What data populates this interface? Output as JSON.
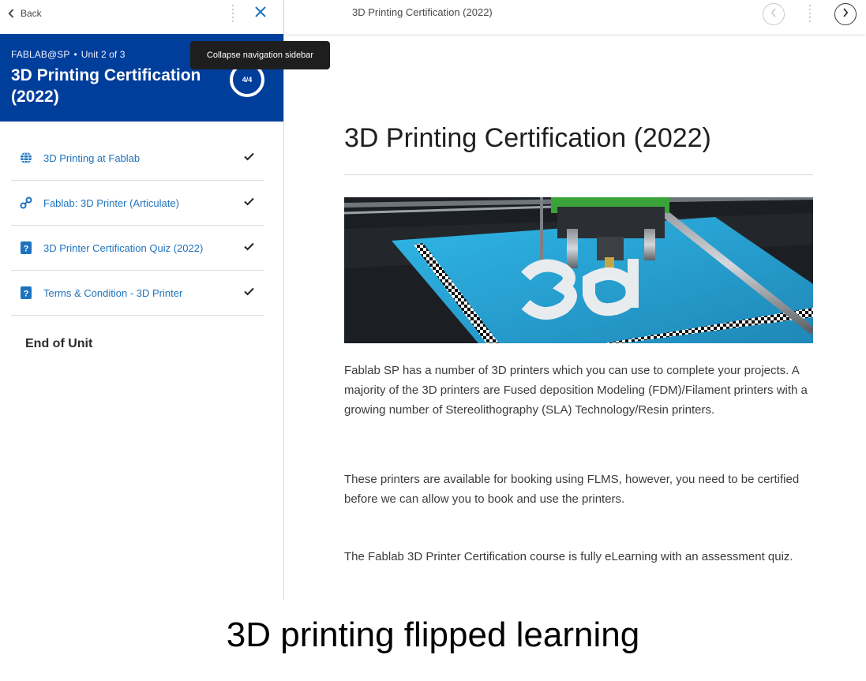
{
  "sidebar": {
    "back_label": "Back",
    "org": "FABLAB@SP",
    "unit_info": "Unit 2 of 3",
    "title": "3D Printing Certification (2022)",
    "progress": "4/4",
    "tooltip": "Collapse navigation sidebar",
    "items": [
      {
        "label": "3D Printing at Fablab",
        "icon": "globe-icon",
        "completed": true
      },
      {
        "label": "Fablab: 3D Printer (Articulate)",
        "icon": "link-icon",
        "completed": true
      },
      {
        "label": "3D Printer Certification Quiz (2022)",
        "icon": "quiz-icon",
        "completed": true
      },
      {
        "label": "Terms & Condition - 3D Printer",
        "icon": "quiz-icon",
        "completed": true
      }
    ],
    "end_label": "End of Unit"
  },
  "topbar": {
    "title": "3D Printing Certification (2022)"
  },
  "content": {
    "heading": "3D Printing Certification (2022)",
    "paragraphs": [
      "Fablab SP has a number of 3D printers which you can use to complete your projects.  A majority of the 3D printers are Fused deposition Modeling (FDM)/Filament printers with a growing number of Stereolithography (SLA) Technology/Resin printers.",
      "These printers are available for booking using FLMS, however, you need to be certified before we can allow you to book and use the printers.",
      "The Fablab 3D Printer Certification course is fully eLearning with an assessment quiz."
    ]
  },
  "caption": "3D printing flipped learning",
  "colors": {
    "brand_blue": "#003e9c",
    "link_blue": "#1e73be",
    "tooltip_bg": "#1e1e1e",
    "bed_blue": "#2aa7d8"
  }
}
